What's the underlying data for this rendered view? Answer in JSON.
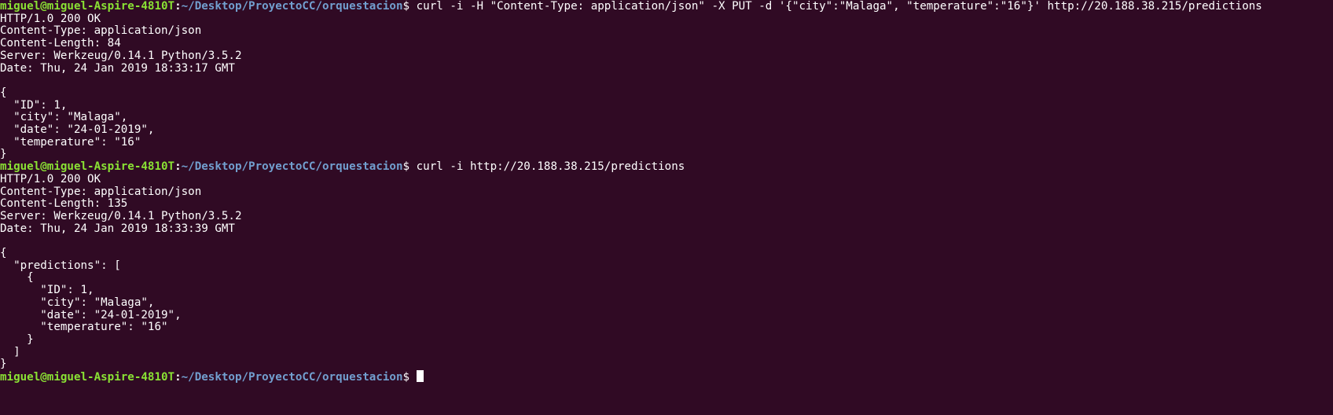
{
  "terminal": {
    "prompt": {
      "user_host": "miguel@miguel-Aspire-4810T",
      "colon": ":",
      "path": "~/Desktop/ProyectoCC/orquestacion",
      "symbol": "$ "
    },
    "lines": [
      {
        "type": "prompt",
        "command": "curl -i -H \"Content-Type: application/json\" -X PUT -d '{\"city\":\"Malaga\", \"temperature\":\"16\"}' http://20.188.38.215/predictions"
      },
      {
        "type": "output",
        "text": "HTTP/1.0 200 OK"
      },
      {
        "type": "output",
        "text": "Content-Type: application/json"
      },
      {
        "type": "output",
        "text": "Content-Length: 84"
      },
      {
        "type": "output",
        "text": "Server: Werkzeug/0.14.1 Python/3.5.2"
      },
      {
        "type": "output",
        "text": "Date: Thu, 24 Jan 2019 18:33:17 GMT"
      },
      {
        "type": "output",
        "text": ""
      },
      {
        "type": "output",
        "text": "{"
      },
      {
        "type": "output",
        "text": "  \"ID\": 1,"
      },
      {
        "type": "output",
        "text": "  \"city\": \"Malaga\","
      },
      {
        "type": "output",
        "text": "  \"date\": \"24-01-2019\","
      },
      {
        "type": "output",
        "text": "  \"temperature\": \"16\""
      },
      {
        "type": "output",
        "text": "}"
      },
      {
        "type": "prompt",
        "command": "curl -i http://20.188.38.215/predictions"
      },
      {
        "type": "output",
        "text": "HTTP/1.0 200 OK"
      },
      {
        "type": "output",
        "text": "Content-Type: application/json"
      },
      {
        "type": "output",
        "text": "Content-Length: 135"
      },
      {
        "type": "output",
        "text": "Server: Werkzeug/0.14.1 Python/3.5.2"
      },
      {
        "type": "output",
        "text": "Date: Thu, 24 Jan 2019 18:33:39 GMT"
      },
      {
        "type": "output",
        "text": ""
      },
      {
        "type": "output",
        "text": "{"
      },
      {
        "type": "output",
        "text": "  \"predictions\": ["
      },
      {
        "type": "output",
        "text": "    {"
      },
      {
        "type": "output",
        "text": "      \"ID\": 1,"
      },
      {
        "type": "output",
        "text": "      \"city\": \"Malaga\","
      },
      {
        "type": "output",
        "text": "      \"date\": \"24-01-2019\","
      },
      {
        "type": "output",
        "text": "      \"temperature\": \"16\""
      },
      {
        "type": "output",
        "text": "    }"
      },
      {
        "type": "output",
        "text": "  ]"
      },
      {
        "type": "output",
        "text": "}"
      },
      {
        "type": "prompt",
        "command": "",
        "cursor": true
      }
    ]
  }
}
